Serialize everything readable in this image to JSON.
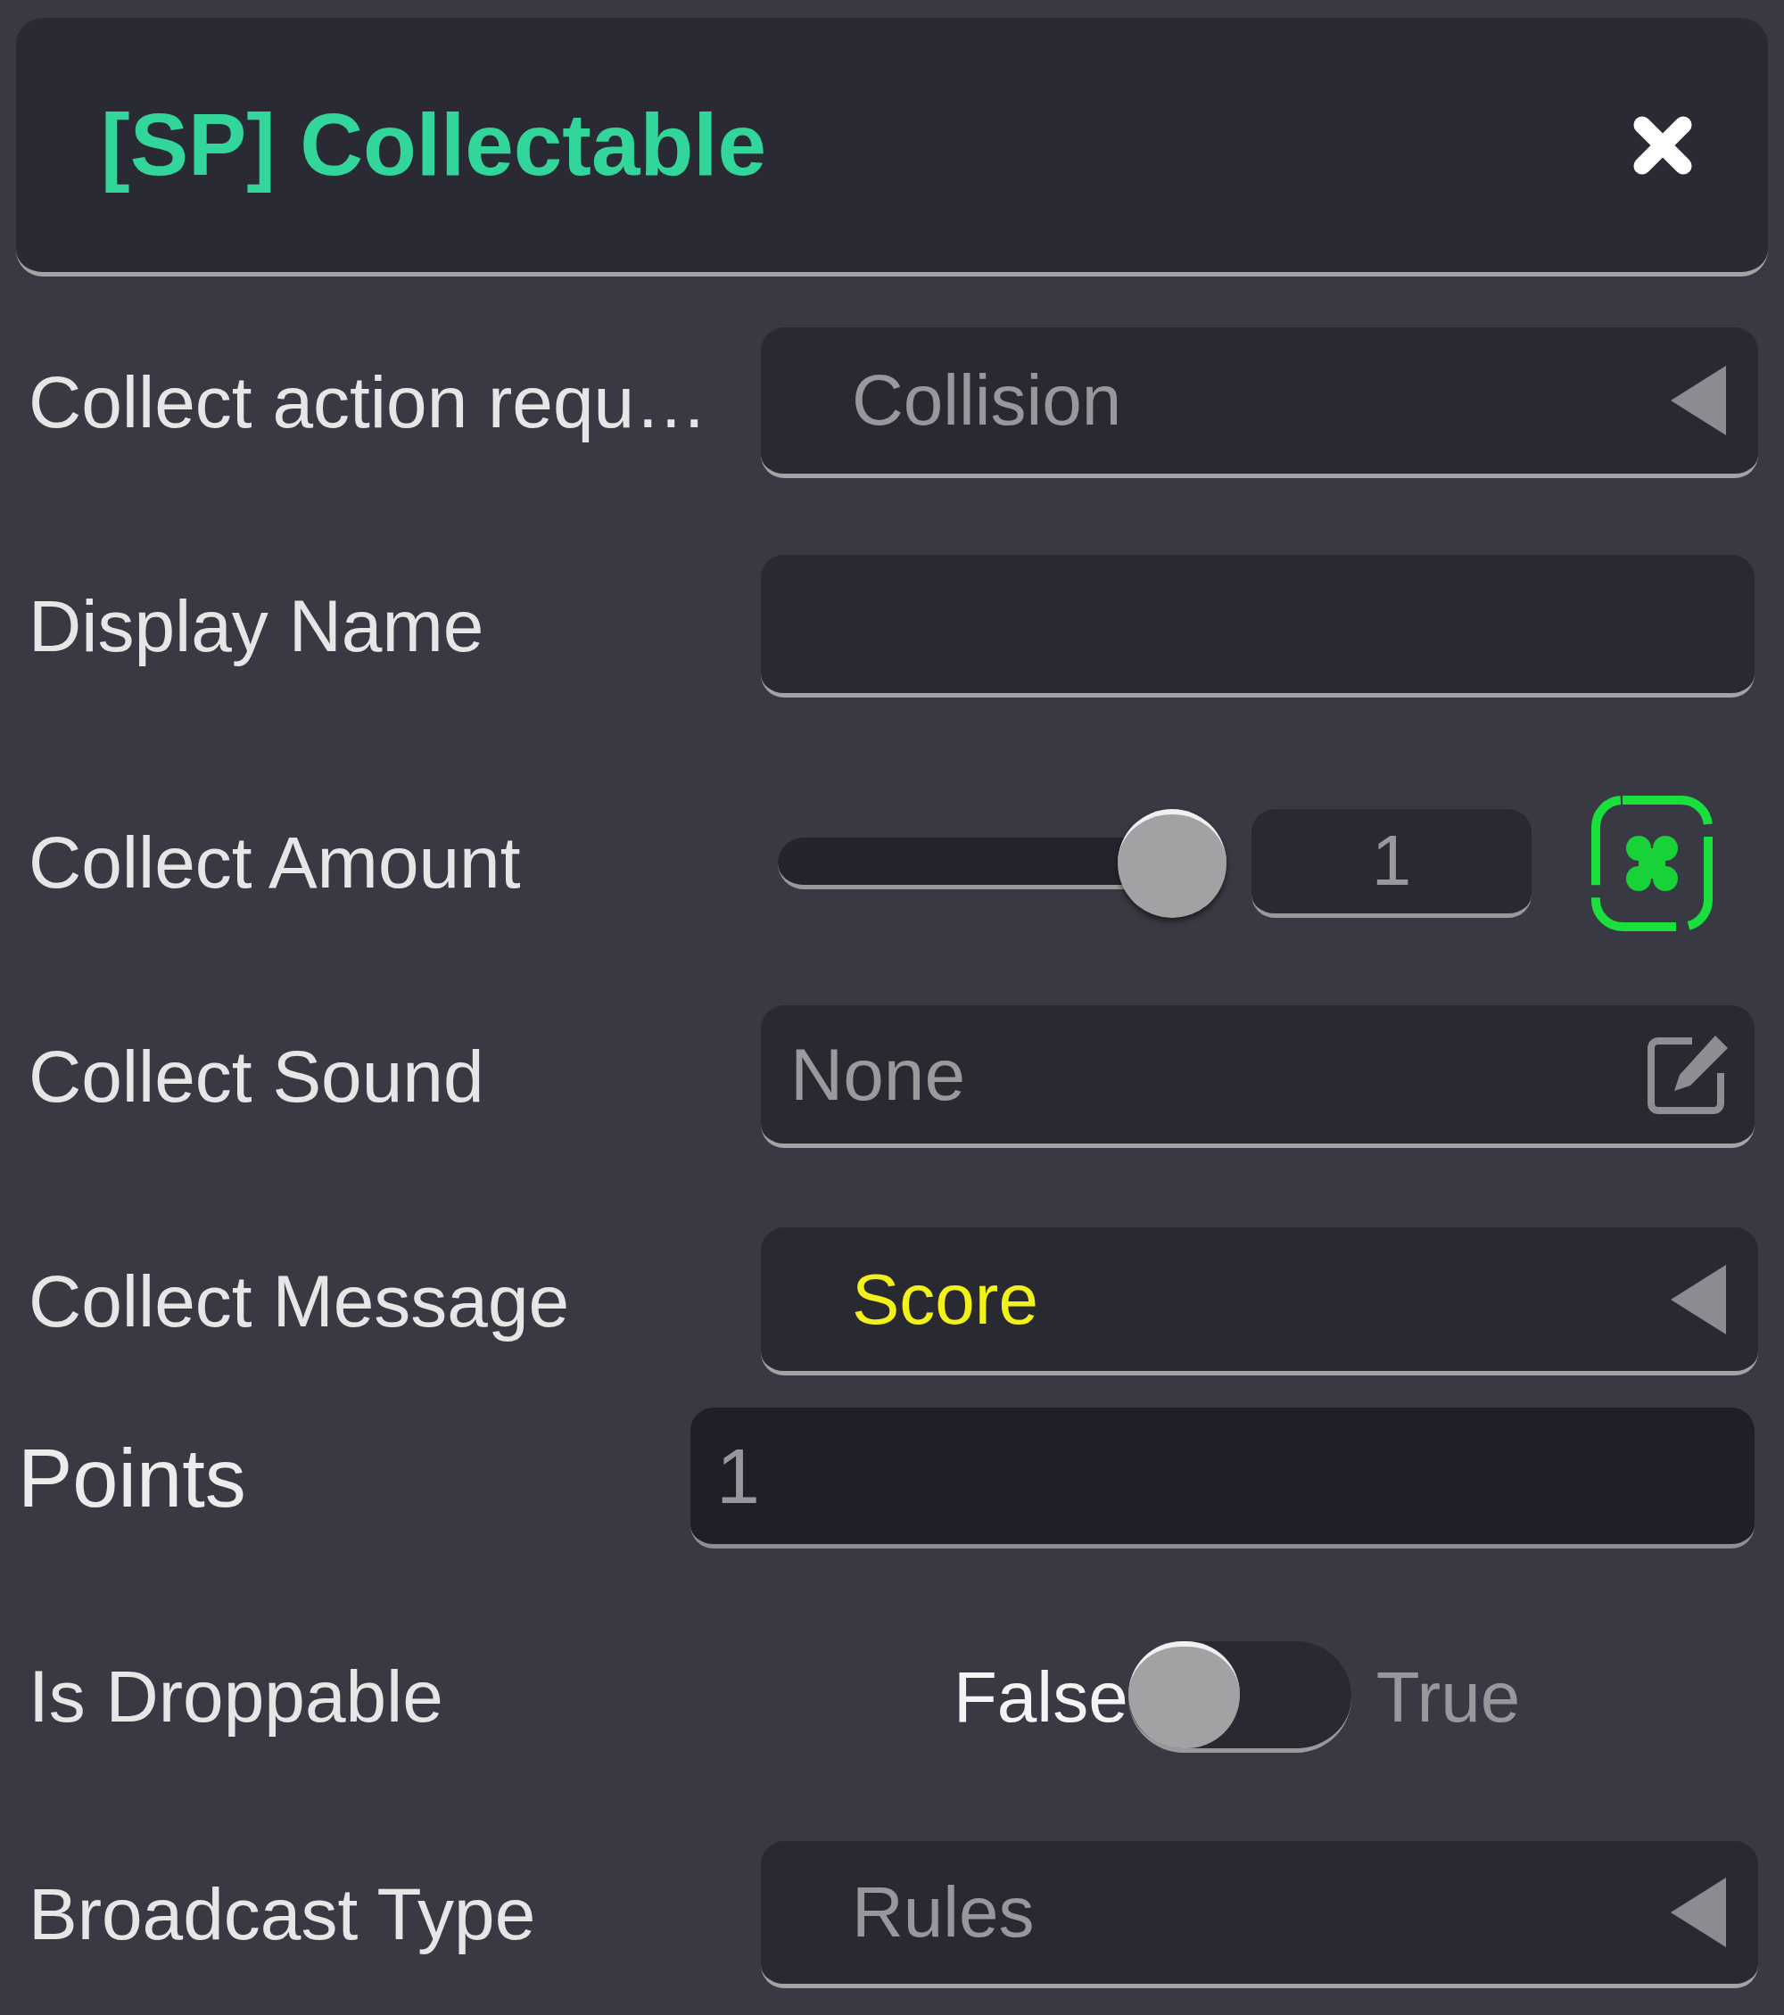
{
  "panel": {
    "title": "[SP] Collectable"
  },
  "rows": [
    {
      "kind": "dropdown",
      "label": "Collect action requ…",
      "value": "Collision",
      "highlighted": false
    },
    {
      "kind": "text",
      "label": "Display Name"
    },
    {
      "kind": "slider",
      "label": "Collect Amount",
      "level": 1,
      "value": "1"
    },
    {
      "kind": "asset",
      "label": "Collect Sound",
      "value": "None"
    },
    {
      "kind": "dropdown",
      "label": "Collect Message",
      "value": "Score",
      "highlighted": true
    },
    {
      "kind": "number",
      "label": "Points",
      "value": "1"
    },
    {
      "kind": "toggle",
      "label": "Is Droppable",
      "off_label": "False",
      "on_label": "True",
      "on": false
    },
    {
      "kind": "dropdown",
      "label": "Broadcast Type",
      "value": "Rules",
      "highlighted": false
    }
  ]
}
